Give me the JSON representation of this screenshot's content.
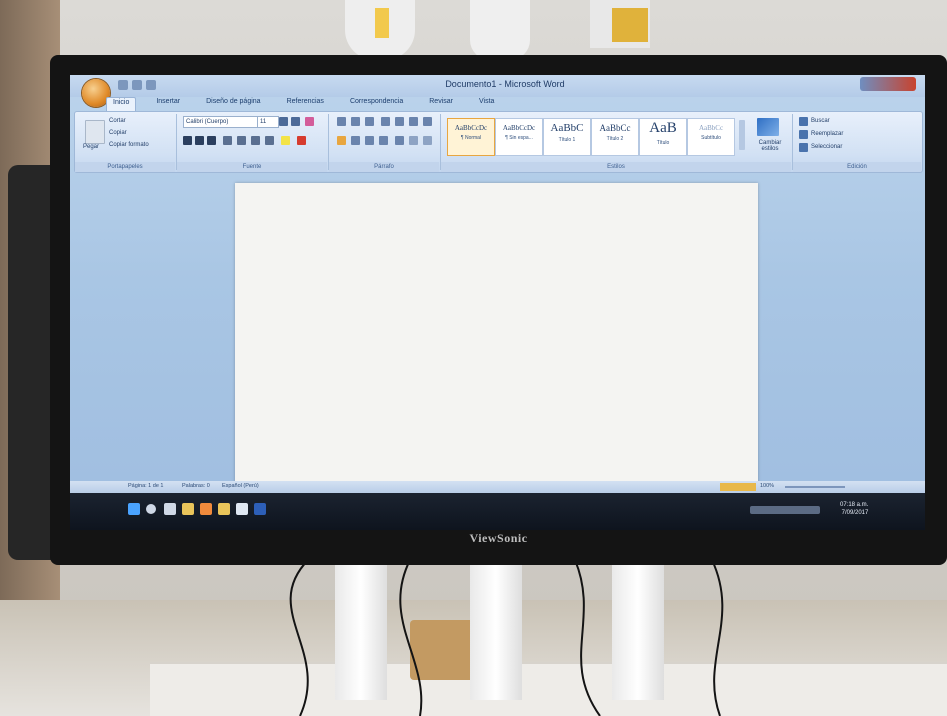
{
  "monitor": {
    "brand": "ViewSonic"
  },
  "window": {
    "title": "Documento1 - Microsoft Word",
    "tabs": [
      "Inicio",
      "Insertar",
      "Diseño de página",
      "Referencias",
      "Correspondencia",
      "Revisar",
      "Vista"
    ],
    "active_tab": "Inicio"
  },
  "ribbon": {
    "clipboard": {
      "paste": "Pegar",
      "cut": "Cortar",
      "copy": "Copiar",
      "format_painter": "Copiar formato",
      "label": "Portapapeles"
    },
    "font": {
      "family": "Calibri (Cuerpo)",
      "size": "11",
      "label": "Fuente"
    },
    "paragraph": {
      "label": "Párrafo"
    },
    "styles": {
      "label": "Estilos",
      "items": [
        {
          "preview": "AaBbCcDc",
          "name": "¶ Normal"
        },
        {
          "preview": "AaBbCcDc",
          "name": "¶ Sin espa..."
        },
        {
          "preview": "AaBbC",
          "name": "Título 1"
        },
        {
          "preview": "AaBbCc",
          "name": "Título 2"
        },
        {
          "preview": "AaB",
          "name": "Título"
        },
        {
          "preview": "AaBbCc",
          "name": "Subtítulo"
        }
      ],
      "change": "Cambiar estilos"
    },
    "editing": {
      "find": "Buscar",
      "replace": "Reemplazar",
      "select": "Seleccionar",
      "label": "Edición"
    }
  },
  "status": {
    "page": "Página: 1 de 1",
    "words": "Palabras: 0",
    "language": "Español (Perú)",
    "zoom": "100%"
  },
  "taskbar": {
    "time": "07:18 a.m.",
    "date": "7/09/2017"
  },
  "colors": {
    "ribbon": "#d2e1f4",
    "taskbar": "#0e141e",
    "office_orange": "#e08a28"
  }
}
